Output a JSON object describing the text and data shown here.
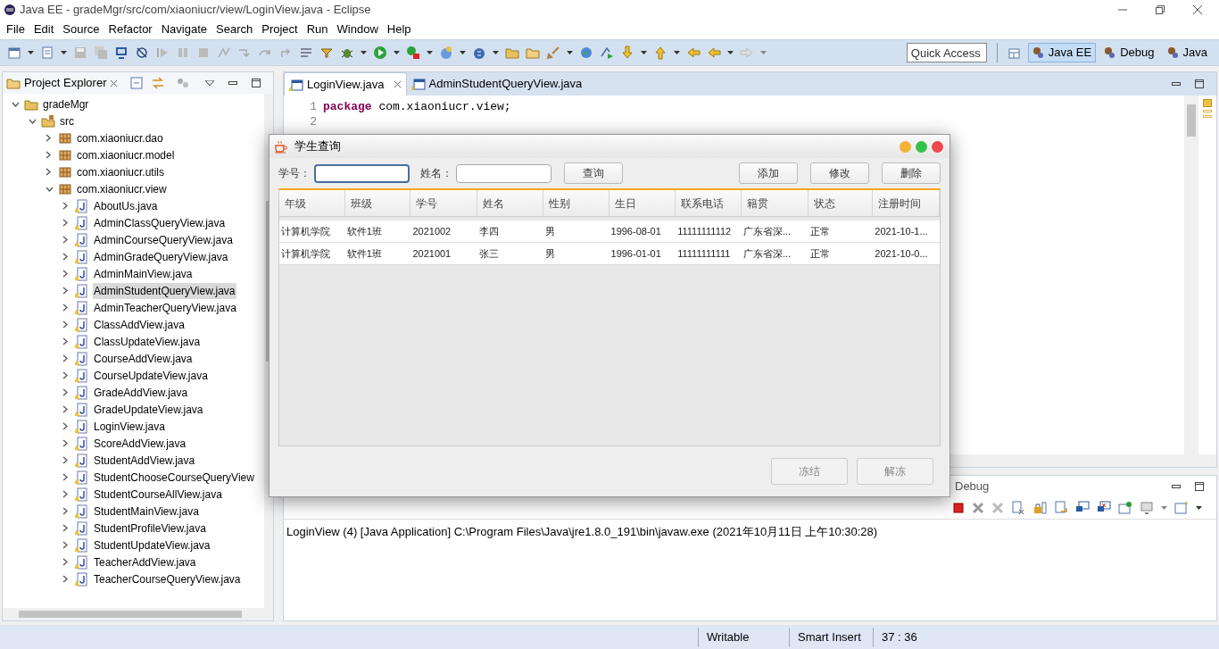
{
  "window": {
    "title": "Java EE - gradeMgr/src/com/xiaoniucr/view/LoginView.java - Eclipse"
  },
  "menu": [
    "File",
    "Edit",
    "Source",
    "Refactor",
    "Navigate",
    "Search",
    "Project",
    "Run",
    "Window",
    "Help"
  ],
  "quick_access": {
    "placeholder": "Quick Access"
  },
  "perspectives": [
    {
      "label": "Java EE",
      "selected": true
    },
    {
      "label": "Debug",
      "selected": false
    },
    {
      "label": "Java",
      "selected": false
    }
  ],
  "project_explorer": {
    "title": "Project Explorer",
    "tree": [
      {
        "label": "gradeMgr",
        "kind": "project",
        "expanded": true,
        "selected": false,
        "children": [
          {
            "label": "src",
            "kind": "folder",
            "expanded": true,
            "selected": false,
            "children": [
              {
                "label": "com.xiaoniucr.dao",
                "kind": "package",
                "expanded": false,
                "selected": false
              },
              {
                "label": "com.xiaoniucr.model",
                "kind": "package",
                "expanded": false,
                "selected": false
              },
              {
                "label": "com.xiaoniucr.utils",
                "kind": "package",
                "expanded": false,
                "selected": false
              },
              {
                "label": "com.xiaoniucr.view",
                "kind": "package",
                "expanded": true,
                "selected": false,
                "children": [
                  {
                    "label": "AboutUs.java",
                    "kind": "file",
                    "expanded": false,
                    "selected": false
                  },
                  {
                    "label": "AdminClassQueryView.java",
                    "kind": "file",
                    "expanded": false,
                    "selected": false
                  },
                  {
                    "label": "AdminCourseQueryView.java",
                    "kind": "file",
                    "expanded": false,
                    "selected": false
                  },
                  {
                    "label": "AdminGradeQueryView.java",
                    "kind": "file",
                    "expanded": false,
                    "selected": false
                  },
                  {
                    "label": "AdminMainView.java",
                    "kind": "file",
                    "expanded": false,
                    "selected": false
                  },
                  {
                    "label": "AdminStudentQueryView.java",
                    "kind": "file",
                    "expanded": false,
                    "selected": true
                  },
                  {
                    "label": "AdminTeacherQueryView.java",
                    "kind": "file",
                    "expanded": false,
                    "selected": false
                  },
                  {
                    "label": "ClassAddView.java",
                    "kind": "file",
                    "expanded": false,
                    "selected": false
                  },
                  {
                    "label": "ClassUpdateView.java",
                    "kind": "file",
                    "expanded": false,
                    "selected": false
                  },
                  {
                    "label": "CourseAddView.java",
                    "kind": "file",
                    "expanded": false,
                    "selected": false
                  },
                  {
                    "label": "CourseUpdateView.java",
                    "kind": "file",
                    "expanded": false,
                    "selected": false
                  },
                  {
                    "label": "GradeAddView.java",
                    "kind": "file",
                    "expanded": false,
                    "selected": false
                  },
                  {
                    "label": "GradeUpdateView.java",
                    "kind": "file",
                    "expanded": false,
                    "selected": false
                  },
                  {
                    "label": "LoginView.java",
                    "kind": "file",
                    "expanded": false,
                    "selected": false
                  },
                  {
                    "label": "ScoreAddView.java",
                    "kind": "file",
                    "expanded": false,
                    "selected": false
                  },
                  {
                    "label": "StudentAddView.java",
                    "kind": "file",
                    "expanded": false,
                    "selected": false
                  },
                  {
                    "label": "StudentChooseCourseQueryView",
                    "kind": "file",
                    "expanded": false,
                    "selected": false
                  },
                  {
                    "label": "StudentCourseAllView.java",
                    "kind": "file",
                    "expanded": false,
                    "selected": false
                  },
                  {
                    "label": "StudentMainView.java",
                    "kind": "file",
                    "expanded": false,
                    "selected": false
                  },
                  {
                    "label": "StudentProfileView.java",
                    "kind": "file",
                    "expanded": false,
                    "selected": false
                  },
                  {
                    "label": "StudentUpdateView.java",
                    "kind": "file",
                    "expanded": false,
                    "selected": false
                  },
                  {
                    "label": "TeacherAddView.java",
                    "kind": "file",
                    "expanded": false,
                    "selected": false
                  },
                  {
                    "label": "TeacherCourseQueryView.java",
                    "kind": "file",
                    "expanded": false,
                    "selected": false
                  }
                ]
              }
            ]
          }
        ]
      }
    ]
  },
  "editor": {
    "tabs": [
      {
        "label": "LoginView.java",
        "selected": true
      },
      {
        "label": "AdminStudentQueryView.java",
        "selected": false
      }
    ],
    "lines": [
      {
        "number": "1",
        "keyword": "package",
        "code": "com.xiaoniucr.view;"
      },
      {
        "number": "2"
      }
    ]
  },
  "console": {
    "tab": "Debug",
    "text": "LoginView (4) [Java Application] C:\\Program Files\\Java\\jre1.8.0_191\\bin\\javaw.exe (2021年10月11日 上午10:30:28)"
  },
  "status_bar": [
    "Writable",
    "Smart Insert",
    "37 : 36"
  ],
  "dialog": {
    "title": "学生查询",
    "window_buttons": [
      {
        "color": "#f5b335"
      },
      {
        "color": "#35c24a"
      },
      {
        "color": "#f0484a"
      }
    ],
    "fields": [
      {
        "label": "学号：",
        "focused": true
      },
      {
        "label": "姓名：",
        "focused": false
      }
    ],
    "search_button": "查询",
    "action_buttons": [
      "添加",
      "修改",
      "删除"
    ],
    "table": {
      "columns": [
        "年级",
        "班级",
        "学号",
        "姓名",
        "性别",
        "生日",
        "联系电话",
        "籍贯",
        "状态",
        "注册时间"
      ],
      "rows": [
        [
          "计算机学院",
          "软件1班",
          "2021002",
          "李四",
          "男",
          "1996-08-01",
          "11111111112",
          "广东省深...",
          "正常",
          "2021-10-1..."
        ],
        [
          "计算机学院",
          "软件1班",
          "2021001",
          "张三",
          "男",
          "1996-01-01",
          "11111111111",
          "广东省深...",
          "正常",
          "2021-10-0..."
        ]
      ]
    },
    "footer_buttons": [
      {
        "label": "冻结",
        "disabled": true
      },
      {
        "label": "解冻",
        "disabled": true
      }
    ]
  }
}
